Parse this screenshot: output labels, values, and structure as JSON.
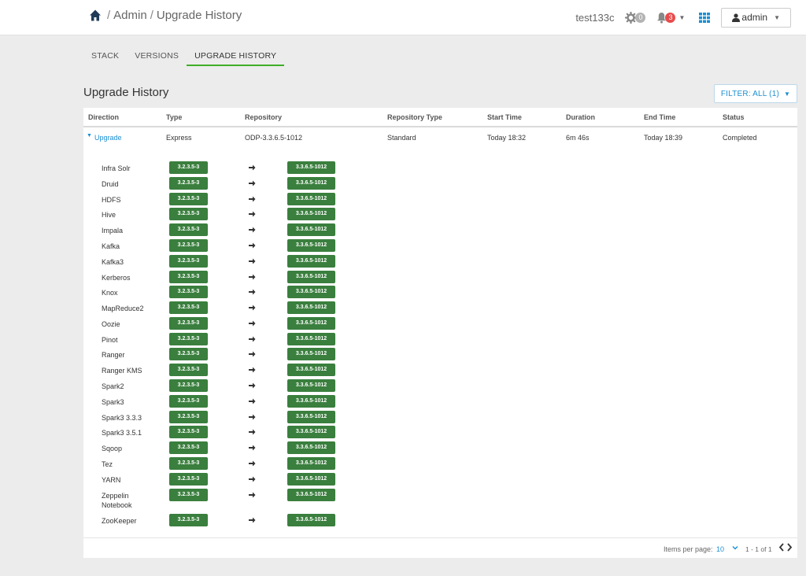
{
  "header": {
    "breadcrumb": [
      "Admin",
      "Upgrade History"
    ],
    "separator": "/",
    "cluster_name": "test133c",
    "ops_count": "0",
    "alerts_count": "3",
    "user_label": "admin"
  },
  "tabs": [
    {
      "label": "STACK",
      "active": false
    },
    {
      "label": "VERSIONS",
      "active": false
    },
    {
      "label": "UPGRADE HISTORY",
      "active": true
    }
  ],
  "section": {
    "title": "Upgrade History",
    "filter_label": "FILTER: ALL (1)"
  },
  "table": {
    "columns": [
      "Direction",
      "Type",
      "Repository",
      "Repository Type",
      "Start Time",
      "Duration",
      "End Time",
      "Status"
    ],
    "row": {
      "direction": "Upgrade",
      "type": "Express",
      "repository": "ODP-3.3.6.5-1012",
      "repository_type": "Standard",
      "start_time": "Today 18:32",
      "duration": "6m 46s",
      "end_time": "Today 18:39",
      "status": "Completed"
    },
    "services": [
      {
        "name": "Infra Solr",
        "from": "3.2.3.5-3",
        "to": "3.3.6.5-1012"
      },
      {
        "name": "Druid",
        "from": "3.2.3.5-3",
        "to": "3.3.6.5-1012"
      },
      {
        "name": "HDFS",
        "from": "3.2.3.5-3",
        "to": "3.3.6.5-1012"
      },
      {
        "name": "Hive",
        "from": "3.2.3.5-3",
        "to": "3.3.6.5-1012"
      },
      {
        "name": "Impala",
        "from": "3.2.3.5-3",
        "to": "3.3.6.5-1012"
      },
      {
        "name": "Kafka",
        "from": "3.2.3.5-3",
        "to": "3.3.6.5-1012"
      },
      {
        "name": "Kafka3",
        "from": "3.2.3.5-3",
        "to": "3.3.6.5-1012"
      },
      {
        "name": "Kerberos",
        "from": "3.2.3.5-3",
        "to": "3.3.6.5-1012"
      },
      {
        "name": "Knox",
        "from": "3.2.3.5-3",
        "to": "3.3.6.5-1012"
      },
      {
        "name": "MapReduce2",
        "from": "3.2.3.5-3",
        "to": "3.3.6.5-1012"
      },
      {
        "name": "Oozie",
        "from": "3.2.3.5-3",
        "to": "3.3.6.5-1012"
      },
      {
        "name": "Pinot",
        "from": "3.2.3.5-3",
        "to": "3.3.6.5-1012"
      },
      {
        "name": "Ranger",
        "from": "3.2.3.5-3",
        "to": "3.3.6.5-1012"
      },
      {
        "name": "Ranger KMS",
        "from": "3.2.3.5-3",
        "to": "3.3.6.5-1012"
      },
      {
        "name": "Spark2",
        "from": "3.2.3.5-3",
        "to": "3.3.6.5-1012"
      },
      {
        "name": "Spark3",
        "from": "3.2.3.5-3",
        "to": "3.3.6.5-1012"
      },
      {
        "name": "Spark3 3.3.3",
        "from": "3.2.3.5-3",
        "to": "3.3.6.5-1012"
      },
      {
        "name": "Spark3 3.5.1",
        "from": "3.2.3.5-3",
        "to": "3.3.6.5-1012"
      },
      {
        "name": "Sqoop",
        "from": "3.2.3.5-3",
        "to": "3.3.6.5-1012"
      },
      {
        "name": "Tez",
        "from": "3.2.3.5-3",
        "to": "3.3.6.5-1012"
      },
      {
        "name": "YARN",
        "from": "3.2.3.5-3",
        "to": "3.3.6.5-1012"
      },
      {
        "name": "Zeppelin Notebook",
        "from": "3.2.3.5-3",
        "to": "3.3.6.5-1012"
      },
      {
        "name": "ZooKeeper",
        "from": "3.2.3.5-3",
        "to": "3.3.6.5-1012"
      }
    ]
  },
  "footer": {
    "items_per_page_label": "Items per page:",
    "items_per_page_value": "10",
    "page_info": "1 - 1 of 1"
  },
  "colors": {
    "accent": "#1b8fd1",
    "version_badge": "#3a7f3e",
    "active_tab": "#3fae2a",
    "alert_badge": "#e84b4b"
  }
}
